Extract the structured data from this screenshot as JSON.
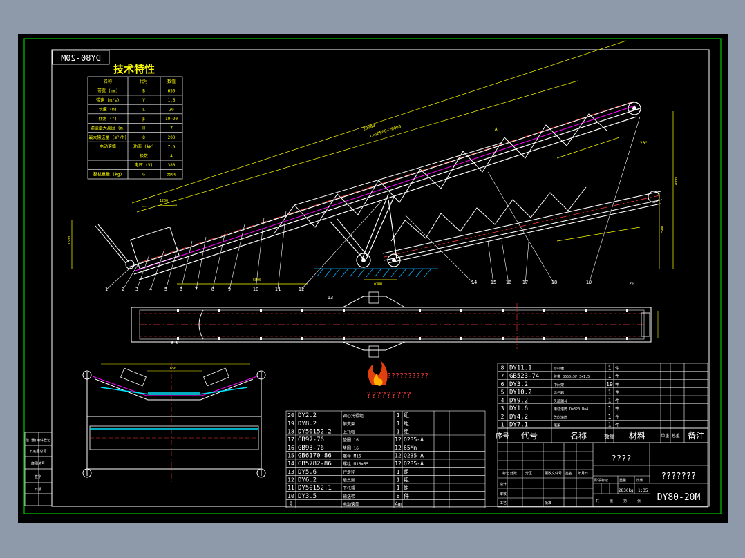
{
  "drawing_code": "DY80-20M",
  "mirrored_code": "DY80-20M",
  "tech_title": "技术特性",
  "spec_table": {
    "header": [
      "名称",
      "代号",
      "数值"
    ],
    "rows": [
      [
        "带宽 (mm)",
        "B",
        "650"
      ],
      [
        "带速 (m/s)",
        "V",
        "1.6"
      ],
      [
        "长度 (m)",
        "L",
        "20"
      ],
      [
        "倾角 (°)",
        "β",
        "10~20"
      ],
      [
        "输送最大高度 (m)",
        "H",
        "7"
      ],
      [
        "最大输送量 (m³/h)",
        "Q",
        "200"
      ],
      [
        "电动滚筒",
        "功率 (kW)",
        "7.5"
      ],
      [
        "",
        "极数",
        "4"
      ],
      [
        "",
        "电压 (V)",
        "380"
      ],
      [
        "整机重量 (kg)",
        "G",
        "3500"
      ]
    ]
  },
  "dimensions": {
    "total_length": "20000",
    "travel": "L=18500~20000",
    "d1": "1200",
    "d2": "5800",
    "d3": "1800",
    "d4": "650",
    "wheel_base": "Φ300",
    "height_right": "7000",
    "width_right": "2500",
    "left_height": "1500",
    "angle": "20°",
    "section_a": "A",
    "section_b": "B-B"
  },
  "callouts": [
    "1",
    "2",
    "3",
    "4",
    "5",
    "6",
    "7",
    "8",
    "9",
    "10",
    "11",
    "12",
    "13",
    "14",
    "15",
    "16",
    "17",
    "18",
    "19",
    "20"
  ],
  "watermark": {
    "line1": "??????????",
    "line2": "?????????"
  },
  "bom_left": [
    [
      "20",
      "DY2.2",
      "调心托辊组",
      "1",
      "组"
    ],
    [
      "19",
      "DY8.2",
      "前支架",
      "1",
      "组"
    ],
    [
      "18",
      "DY50152.2",
      "上托辊",
      "1",
      "组"
    ],
    [
      "17",
      "GB97-76",
      "垫圈 16",
      "12",
      "Q235-A"
    ],
    [
      "16",
      "GB93-76",
      "垫圈 16",
      "12",
      "65Mn"
    ],
    [
      "15",
      "GB6170-86",
      "螺母 M16",
      "12",
      "Q235-A"
    ],
    [
      "14",
      "GB5782-86",
      "螺栓 M16×55",
      "12",
      "Q235-A"
    ],
    [
      "13",
      "DY5.6",
      "行走轮",
      "1",
      "组"
    ],
    [
      "12",
      "DY6.2",
      "后支架",
      "1",
      "组"
    ],
    [
      "11",
      "DY50152.1",
      "下托辊",
      "1",
      "组"
    ],
    [
      "10",
      "DY3.5",
      "输送带",
      "8",
      "件"
    ],
    [
      "9",
      "",
      "电动滚筒",
      "4m",
      ""
    ]
  ],
  "bom_right": [
    [
      "8",
      "DY11.1",
      "导料槽",
      "1",
      "件"
    ],
    [
      "7",
      "GB523-74",
      "胶带 B650×5P 3+1.5",
      "1",
      "件"
    ],
    [
      "6",
      "DY3.2",
      "中间架",
      "19",
      "件"
    ],
    [
      "5",
      "DY10.2",
      "清扫器",
      "1",
      "件"
    ],
    [
      "4",
      "DY9.2",
      "头部漏斗",
      "1",
      "件"
    ],
    [
      "3",
      "DY1.6",
      "电动滚筒 D=320 N=4",
      "1",
      "件"
    ],
    [
      "2",
      "DY4.2",
      "改向滚筒",
      "1",
      "件"
    ],
    [
      "1",
      "DY7.1",
      "尾架",
      "1",
      "件"
    ]
  ],
  "bom_header": {
    "seq": "序号",
    "code": "代号",
    "name": "名称",
    "qty": "数量",
    "material": "材料",
    "weight": "单重 总重",
    "remark": "备注"
  },
  "title_block": {
    "company": "????",
    "drawing_name": "???????",
    "code": "DY80-20M",
    "scale": "1:35",
    "weight": "2830kg",
    "labels": [
      "标记",
      "处数",
      "分区",
      "更改文件号",
      "签名",
      "年月日"
    ],
    "rows": [
      "设计",
      "审核",
      "工艺",
      "批准"
    ],
    "stage_labels": [
      "阶段标记",
      "重量",
      "比例"
    ],
    "sheet_labels": [
      "共",
      "张",
      "第",
      "张"
    ]
  },
  "side_stamp": [
    "借(通)用件登记",
    "旧底图总号",
    "底图总号",
    "签字",
    "日期"
  ]
}
